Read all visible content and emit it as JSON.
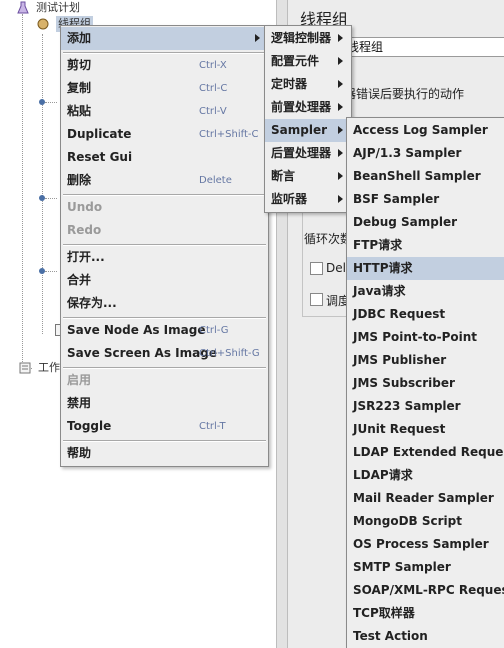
{
  "tree": {
    "test_plan": "测试计划",
    "thread_group": "线程组",
    "workbench": "工作"
  },
  "right_panel": {
    "title": "线程组",
    "name_value": "线程组",
    "error_action_fragment": "器错误后要执行的动作",
    "loop_fragment": "循环次数",
    "delay_fragment": "Dela",
    "scheduler_fragment": "调度"
  },
  "context_menu": {
    "items": [
      {
        "label": "添加",
        "accel": "",
        "submenu": true,
        "highlighted": true,
        "disabled": false
      },
      {
        "label": "剪切",
        "accel": "Ctrl-X",
        "disabled": false
      },
      {
        "label": "复制",
        "accel": "Ctrl-C",
        "disabled": false
      },
      {
        "label": "粘贴",
        "accel": "Ctrl-V",
        "disabled": false
      },
      {
        "label": "Duplicate",
        "accel": "Ctrl+Shift-C",
        "disabled": false
      },
      {
        "label": "Reset Gui",
        "accel": "",
        "disabled": false
      },
      {
        "label": "删除",
        "accel": "Delete",
        "disabled": false
      },
      {
        "label": "Undo",
        "accel": "",
        "disabled": true
      },
      {
        "label": "Redo",
        "accel": "",
        "disabled": true
      },
      {
        "label": "打开...",
        "accel": "",
        "disabled": false
      },
      {
        "label": "合并",
        "accel": "",
        "disabled": false
      },
      {
        "label": "保存为...",
        "accel": "",
        "disabled": false
      },
      {
        "label": "Save Node As Image",
        "accel": "Ctrl-G",
        "disabled": false
      },
      {
        "label": "Save Screen As Image",
        "accel": "Ctrl+Shift-G",
        "disabled": false
      },
      {
        "label": "启用",
        "accel": "",
        "disabled": true
      },
      {
        "label": "禁用",
        "accel": "",
        "disabled": false
      },
      {
        "label": "Toggle",
        "accel": "Ctrl-T",
        "disabled": false
      },
      {
        "label": "帮助",
        "accel": "",
        "disabled": false
      }
    ]
  },
  "add_menu": {
    "items": [
      {
        "label": "逻辑控制器"
      },
      {
        "label": "配置元件"
      },
      {
        "label": "定时器"
      },
      {
        "label": "前置处理器"
      },
      {
        "label": "Sampler"
      },
      {
        "label": "后置处理器"
      },
      {
        "label": "断言"
      },
      {
        "label": "监听器"
      }
    ]
  },
  "sampler_menu": {
    "items": [
      {
        "label": "Access Log Sampler"
      },
      {
        "label": "AJP/1.3 Sampler"
      },
      {
        "label": "BeanShell Sampler"
      },
      {
        "label": "BSF Sampler"
      },
      {
        "label": "Debug Sampler"
      },
      {
        "label": "FTP请求"
      },
      {
        "label": "HTTP请求"
      },
      {
        "label": "Java请求"
      },
      {
        "label": "JDBC Request"
      },
      {
        "label": "JMS Point-to-Point"
      },
      {
        "label": "JMS Publisher"
      },
      {
        "label": "JMS Subscriber"
      },
      {
        "label": "JSR223 Sampler"
      },
      {
        "label": "JUnit Request"
      },
      {
        "label": "LDAP Extended Request"
      },
      {
        "label": "LDAP请求"
      },
      {
        "label": "Mail Reader Sampler"
      },
      {
        "label": "MongoDB Script"
      },
      {
        "label": "OS Process Sampler"
      },
      {
        "label": "SMTP Sampler"
      },
      {
        "label": "SOAP/XML-RPC Request"
      },
      {
        "label": "TCP取样器"
      },
      {
        "label": "Test Action"
      }
    ]
  }
}
